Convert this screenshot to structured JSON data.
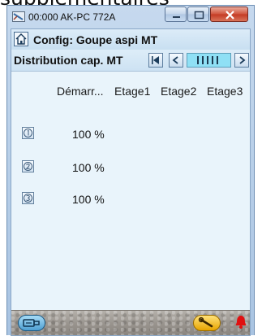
{
  "top_text": "supplementaires",
  "window": {
    "title": "00:000 AK-PC 772A",
    "buttons": {
      "minimize": "—",
      "maximize": "□",
      "close": "X"
    }
  },
  "header": {
    "title": "Config: Goupe aspi MT"
  },
  "subheader": {
    "title": "Distribution cap. MT"
  },
  "table": {
    "columns": [
      "Démarr...",
      "Etage1",
      "Etage2",
      "Etage3"
    ],
    "rows": [
      {
        "icon": "badge-1-icon",
        "value": "100 %"
      },
      {
        "icon": "badge-2-icon",
        "value": "100 %"
      },
      {
        "icon": "badge-3-icon",
        "value": "100 %"
      }
    ]
  },
  "colors": {
    "client_bg": "#e9f4fb",
    "nav_accent": "#8fe0f5",
    "close_button": "#c43a23",
    "footer_tool": "#e7a400",
    "alarm": "#e01010"
  }
}
